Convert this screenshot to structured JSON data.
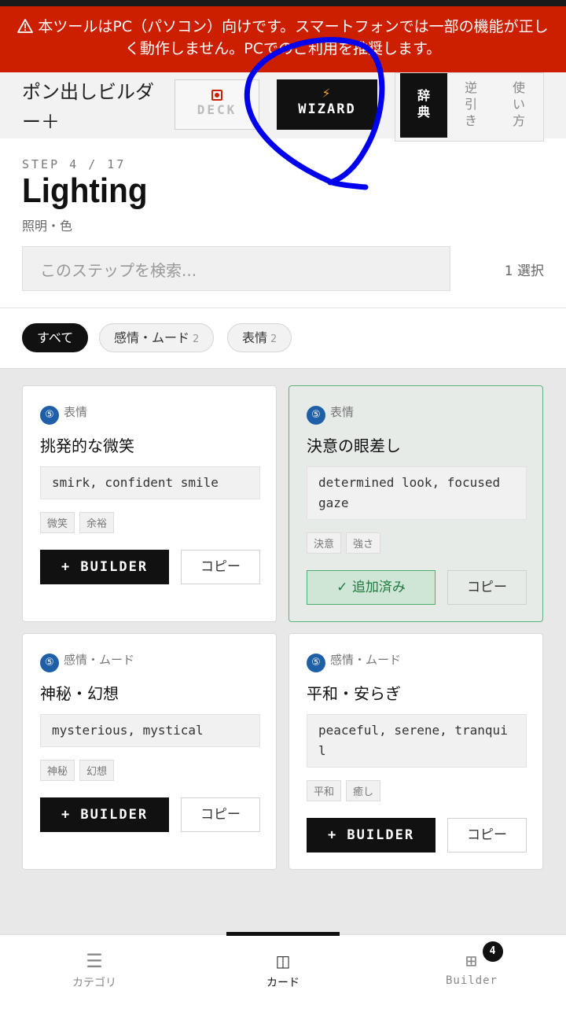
{
  "warning": {
    "icon": "warning-triangle-icon",
    "text": "本ツールはPC（パソコン）向けです。スマートフォンでは一部の機能が正しく動作しません。PCでのご利用を推奨します。"
  },
  "header": {
    "app_title": "ポン出しビルダー＋",
    "deck_label": "DECK",
    "wizard_label": "WIZARD",
    "modes": [
      "辞典",
      "逆引き",
      "使い方"
    ]
  },
  "step": {
    "label": "STEP 4 / 17",
    "title": "Lighting",
    "subtitle": "照明・色"
  },
  "search": {
    "placeholder": "このステップを検索...",
    "selected": "1 選択"
  },
  "chips": [
    {
      "label": "すべて",
      "count": ""
    },
    {
      "label": "感情・ムード",
      "count": "2"
    },
    {
      "label": "表情",
      "count": "2"
    }
  ],
  "cards": [
    {
      "num": "⑤",
      "category": "表情",
      "title": "挑発的な微笑",
      "prompt": "smirk, confident smile",
      "tags": [
        "微笑",
        "余裕"
      ],
      "action": "+ BUILDER",
      "copy": "コピー"
    },
    {
      "num": "⑤",
      "category": "表情",
      "title": "決意の眼差し",
      "prompt": "determined look, focused gaze",
      "tags": [
        "決意",
        "強さ"
      ],
      "action": "✓ 追加済み",
      "copy": "コピー"
    },
    {
      "num": "⑤",
      "category": "感情・ムード",
      "title": "神秘・幻想",
      "prompt": "mysterious, mystical",
      "tags": [
        "神秘",
        "幻想"
      ],
      "action": "+ BUILDER",
      "copy": "コピー"
    },
    {
      "num": "⑤",
      "category": "感情・ムード",
      "title": "平和・安らぎ",
      "prompt": "peaceful, serene, tranquil",
      "tags": [
        "平和",
        "癒し"
      ],
      "action": "+ BUILDER",
      "copy": "コピー"
    }
  ],
  "nav": [
    {
      "icon": "☰",
      "label": "カテゴリ"
    },
    {
      "icon": "▯▯",
      "label": "カード"
    },
    {
      "icon": "⊞",
      "label": "Builder",
      "badge": "4"
    }
  ],
  "colors": {
    "warning_bg": "#cc1f00",
    "accent_added": "#4caf6e",
    "annotation_stroke": "#0000ee"
  }
}
